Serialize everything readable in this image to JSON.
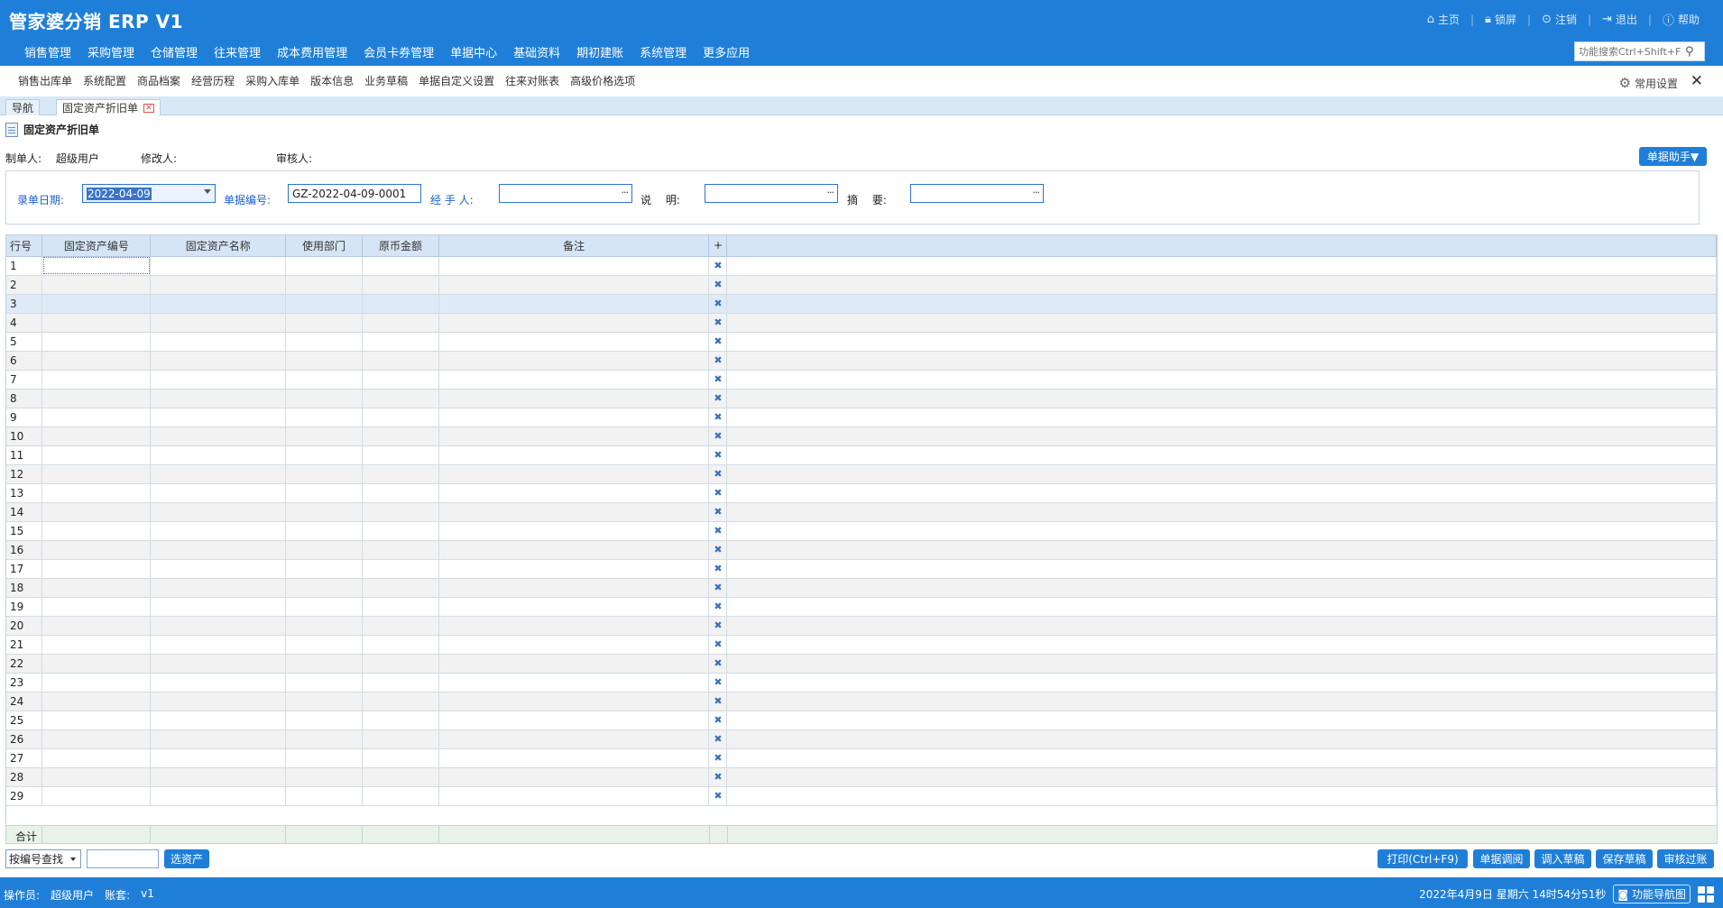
{
  "app": {
    "title": "管家婆分销 ERP V1"
  },
  "top_links": [
    {
      "icon": "home-icon",
      "label": "主页"
    },
    {
      "icon": "lock-icon",
      "label": "锁屏"
    },
    {
      "icon": "logout-circle-icon",
      "label": "注销"
    },
    {
      "icon": "exit-icon",
      "label": "退出"
    },
    {
      "icon": "info-icon",
      "label": "帮助"
    }
  ],
  "main_nav": [
    "销售管理",
    "采购管理",
    "仓储管理",
    "往来管理",
    "成本费用管理",
    "会员卡券管理",
    "单据中心",
    "基础资料",
    "期初建账",
    "系统管理",
    "更多应用"
  ],
  "search": {
    "placeholder": "功能搜索Ctrl+Shift+F"
  },
  "quick_links": [
    "销售出库单",
    "系统配置",
    "商品档案",
    "经营历程",
    "采购入库单",
    "版本信息",
    "业务草稿",
    "单据自定义设置",
    "往来对账表",
    "高级价格选项"
  ],
  "settings": {
    "label": "常用设置"
  },
  "tabs": [
    {
      "label": "导航"
    },
    {
      "label": "固定资产折旧单"
    }
  ],
  "document": {
    "title": "固定资产折旧单"
  },
  "meta": {
    "creator_label": "制单人:",
    "creator_value": "超级用户",
    "modifier_label": "修改人:",
    "modifier_value": "",
    "auditor_label": "审核人:",
    "auditor_value": ""
  },
  "helper_button": {
    "label": "单据助手▼"
  },
  "form": {
    "date_label": "录单日期:",
    "date_value": "2022-04-09",
    "number_label": "单据编号:",
    "number_value": "GZ-2022-04-09-0001",
    "handler_label": "经 手 人:",
    "handler_value": "",
    "note_label": "说　 明:",
    "note_value": "",
    "summary_label": "摘　 要:",
    "summary_value": ""
  },
  "grid": {
    "columns": [
      "行号",
      "固定资产编号",
      "固定资产名称",
      "使用部门",
      "原币金额",
      "备注",
      "+"
    ],
    "row_count": 29,
    "highlight_row": 3,
    "total_label": "合计"
  },
  "bottom_toolbar": {
    "search_mode": "按编号查找",
    "search_value": "",
    "select_asset_button": "选资产",
    "print_button": "打印(Ctrl+F9)",
    "query_button": "单据调阅",
    "load_draft_button": "调入草稿",
    "save_draft_button": "保存草稿",
    "audit_button": "审核过账"
  },
  "status": {
    "operator_label": "操作员:",
    "operator_value": "超级用户",
    "account_label": "账套:",
    "account_value": "v1",
    "datetime": "2022年4月9日  星期六  14时54分51秒",
    "nav_map_button": "功能导航图"
  },
  "colors": {
    "brand": "#1f7fd8",
    "grid_header": "#d6e5f5",
    "label_blue": "#1a5fd1",
    "total_row": "#e8f2e8"
  }
}
